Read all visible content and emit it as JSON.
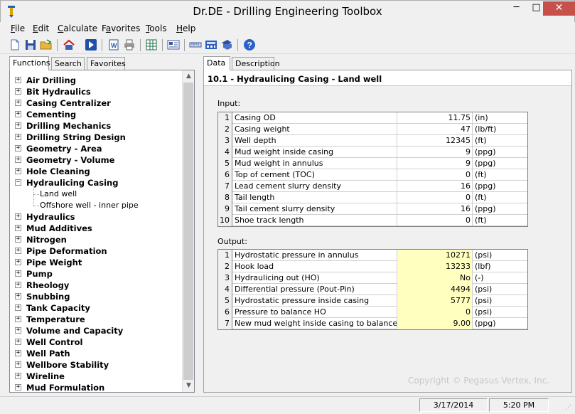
{
  "window": {
    "title": "Dr.DE - Drilling Engineering Toolbox",
    "controls": {
      "minimize": "─",
      "maximize": "□",
      "close": "✕"
    }
  },
  "menu": [
    {
      "label": "File",
      "u": "F",
      "rest": "ile"
    },
    {
      "label": "Edit",
      "u": "E",
      "rest": "dit"
    },
    {
      "label": "Calculate",
      "u": "C",
      "rest": "alculate"
    },
    {
      "label": "Favorites",
      "pre": "F",
      "u": "a",
      "rest": "vorites"
    },
    {
      "label": "Tools",
      "u": "T",
      "rest": "ools"
    },
    {
      "label": "Help",
      "u": "H",
      "rest": "elp"
    }
  ],
  "toolbar": {
    "icons": [
      "new-file-icon",
      "save-icon",
      "open-folder-icon",
      "home-icon",
      "run-icon",
      "word-export-icon",
      "print-icon",
      "excel-export-icon",
      "report-icon",
      "unit-converter-icon",
      "calculator-icon",
      "bookmark-icon",
      "help-icon"
    ]
  },
  "left_tabs": [
    "Functions",
    "Search",
    "Favorites"
  ],
  "tree": {
    "items": [
      {
        "label": "Air Drilling",
        "expanded": false
      },
      {
        "label": "Bit Hydraulics",
        "expanded": false
      },
      {
        "label": "Casing Centralizer",
        "expanded": false
      },
      {
        "label": "Cementing",
        "expanded": false
      },
      {
        "label": "Drilling Mechanics",
        "expanded": false
      },
      {
        "label": "Drilling String Design",
        "expanded": false
      },
      {
        "label": "Geometry - Area",
        "expanded": false
      },
      {
        "label": "Geometry - Volume",
        "expanded": false
      },
      {
        "label": "Hole Cleaning",
        "expanded": false
      },
      {
        "label": "Hydraulicing Casing",
        "expanded": true
      },
      {
        "label": "Hydraulics",
        "expanded": false
      },
      {
        "label": "Mud Additives",
        "expanded": false
      },
      {
        "label": "Nitrogen",
        "expanded": false
      },
      {
        "label": "Pipe Deformation",
        "expanded": false
      },
      {
        "label": "Pipe Weight",
        "expanded": false
      },
      {
        "label": "Pump",
        "expanded": false
      },
      {
        "label": "Rheology",
        "expanded": false
      },
      {
        "label": "Snubbing",
        "expanded": false
      },
      {
        "label": "Tank Capacity",
        "expanded": false
      },
      {
        "label": "Temperature",
        "expanded": false
      },
      {
        "label": "Volume and Capacity",
        "expanded": false
      },
      {
        "label": "Well Control",
        "expanded": false
      },
      {
        "label": "Well Path",
        "expanded": false
      },
      {
        "label": "Wellbore Stability",
        "expanded": false
      },
      {
        "label": "Wireline",
        "expanded": false
      },
      {
        "label": "Mud Formulation",
        "expanded": false
      }
    ],
    "children": [
      "Land well",
      "Offshore well - inner pipe"
    ],
    "expand_symbol": "+",
    "collapse_symbol": "−"
  },
  "right_tabs": [
    "Data",
    "Description"
  ],
  "panel": {
    "title": "10.1 - Hydraulicing Casing - Land well",
    "input_label": "Input:",
    "output_label": "Output:",
    "inputs": [
      {
        "n": "1",
        "name": "Casing OD",
        "value": "11.75",
        "unit": "(in)"
      },
      {
        "n": "2",
        "name": "Casing weight",
        "value": "47",
        "unit": "(lb/ft)"
      },
      {
        "n": "3",
        "name": "Well depth",
        "value": "12345",
        "unit": "(ft)"
      },
      {
        "n": "4",
        "name": "Mud weight inside casing",
        "value": "9",
        "unit": "(ppg)"
      },
      {
        "n": "5",
        "name": "Mud weight in annulus",
        "value": "9",
        "unit": "(ppg)"
      },
      {
        "n": "6",
        "name": "Top of cement (TOC)",
        "value": "0",
        "unit": "(ft)"
      },
      {
        "n": "7",
        "name": "Lead cement slurry density",
        "value": "16",
        "unit": "(ppg)"
      },
      {
        "n": "8",
        "name": "Tail length",
        "value": "0",
        "unit": "(ft)"
      },
      {
        "n": "9",
        "name": "Tail cement slurry density",
        "value": "16",
        "unit": "(ppg)"
      },
      {
        "n": "10",
        "name": "Shoe track length",
        "value": "0",
        "unit": "(ft)"
      }
    ],
    "outputs": [
      {
        "n": "1",
        "name": "Hydrostatic pressure in annulus",
        "value": "10271",
        "unit": "(psi)"
      },
      {
        "n": "2",
        "name": "Hook load",
        "value": "13233",
        "unit": "(lbf)"
      },
      {
        "n": "3",
        "name": "Hydraulicing out (HO)",
        "value": "No",
        "unit": "(-)"
      },
      {
        "n": "4",
        "name": "Differential pressure (Pout-Pin)",
        "value": "4494",
        "unit": "(psi)"
      },
      {
        "n": "5",
        "name": "Hydrostatic pressure inside casing",
        "value": "5777",
        "unit": "(psi)"
      },
      {
        "n": "6",
        "name": "Pressure to balance HO",
        "value": "0",
        "unit": "(psi)"
      },
      {
        "n": "7",
        "name": "New mud weight inside casing to balance HO",
        "value": "9.00",
        "unit": "(ppg)"
      }
    ],
    "copyright": "Copyright © Pegasus Vertex, Inc."
  },
  "status": {
    "date": "3/17/2014",
    "time": "5:20 PM"
  },
  "colors": {
    "output_bg": "#ffffc0",
    "close_btn": "#c7504a"
  }
}
